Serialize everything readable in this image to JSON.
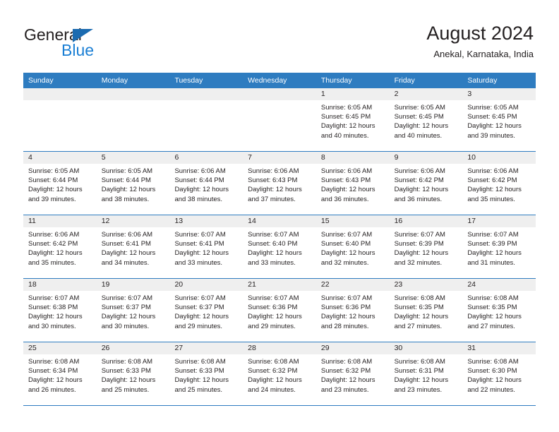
{
  "brand": {
    "name_top": "General",
    "name_bottom": "Blue",
    "triangle_color": "#1b6bb0",
    "blue_color": "#1b7fd4"
  },
  "header": {
    "title": "August 2024",
    "subtitle": "Anekal, Karnataka, India"
  },
  "colors": {
    "header_blue": "#2e7cc0",
    "daynum_gray": "#efefef",
    "text": "#231f20"
  },
  "weekdays": [
    "Sunday",
    "Monday",
    "Tuesday",
    "Wednesday",
    "Thursday",
    "Friday",
    "Saturday"
  ],
  "weeks": [
    [
      {
        "day": "",
        "empty": true
      },
      {
        "day": "",
        "empty": true
      },
      {
        "day": "",
        "empty": true
      },
      {
        "day": "",
        "empty": true
      },
      {
        "day": "1",
        "sunrise": "Sunrise: 6:05 AM",
        "sunset": "Sunset: 6:45 PM",
        "daylight1": "Daylight: 12 hours",
        "daylight2": "and 40 minutes."
      },
      {
        "day": "2",
        "sunrise": "Sunrise: 6:05 AM",
        "sunset": "Sunset: 6:45 PM",
        "daylight1": "Daylight: 12 hours",
        "daylight2": "and 40 minutes."
      },
      {
        "day": "3",
        "sunrise": "Sunrise: 6:05 AM",
        "sunset": "Sunset: 6:45 PM",
        "daylight1": "Daylight: 12 hours",
        "daylight2": "and 39 minutes."
      }
    ],
    [
      {
        "day": "4",
        "sunrise": "Sunrise: 6:05 AM",
        "sunset": "Sunset: 6:44 PM",
        "daylight1": "Daylight: 12 hours",
        "daylight2": "and 39 minutes."
      },
      {
        "day": "5",
        "sunrise": "Sunrise: 6:05 AM",
        "sunset": "Sunset: 6:44 PM",
        "daylight1": "Daylight: 12 hours",
        "daylight2": "and 38 minutes."
      },
      {
        "day": "6",
        "sunrise": "Sunrise: 6:06 AM",
        "sunset": "Sunset: 6:44 PM",
        "daylight1": "Daylight: 12 hours",
        "daylight2": "and 38 minutes."
      },
      {
        "day": "7",
        "sunrise": "Sunrise: 6:06 AM",
        "sunset": "Sunset: 6:43 PM",
        "daylight1": "Daylight: 12 hours",
        "daylight2": "and 37 minutes."
      },
      {
        "day": "8",
        "sunrise": "Sunrise: 6:06 AM",
        "sunset": "Sunset: 6:43 PM",
        "daylight1": "Daylight: 12 hours",
        "daylight2": "and 36 minutes."
      },
      {
        "day": "9",
        "sunrise": "Sunrise: 6:06 AM",
        "sunset": "Sunset: 6:42 PM",
        "daylight1": "Daylight: 12 hours",
        "daylight2": "and 36 minutes."
      },
      {
        "day": "10",
        "sunrise": "Sunrise: 6:06 AM",
        "sunset": "Sunset: 6:42 PM",
        "daylight1": "Daylight: 12 hours",
        "daylight2": "and 35 minutes."
      }
    ],
    [
      {
        "day": "11",
        "sunrise": "Sunrise: 6:06 AM",
        "sunset": "Sunset: 6:42 PM",
        "daylight1": "Daylight: 12 hours",
        "daylight2": "and 35 minutes."
      },
      {
        "day": "12",
        "sunrise": "Sunrise: 6:06 AM",
        "sunset": "Sunset: 6:41 PM",
        "daylight1": "Daylight: 12 hours",
        "daylight2": "and 34 minutes."
      },
      {
        "day": "13",
        "sunrise": "Sunrise: 6:07 AM",
        "sunset": "Sunset: 6:41 PM",
        "daylight1": "Daylight: 12 hours",
        "daylight2": "and 33 minutes."
      },
      {
        "day": "14",
        "sunrise": "Sunrise: 6:07 AM",
        "sunset": "Sunset: 6:40 PM",
        "daylight1": "Daylight: 12 hours",
        "daylight2": "and 33 minutes."
      },
      {
        "day": "15",
        "sunrise": "Sunrise: 6:07 AM",
        "sunset": "Sunset: 6:40 PM",
        "daylight1": "Daylight: 12 hours",
        "daylight2": "and 32 minutes."
      },
      {
        "day": "16",
        "sunrise": "Sunrise: 6:07 AM",
        "sunset": "Sunset: 6:39 PM",
        "daylight1": "Daylight: 12 hours",
        "daylight2": "and 32 minutes."
      },
      {
        "day": "17",
        "sunrise": "Sunrise: 6:07 AM",
        "sunset": "Sunset: 6:39 PM",
        "daylight1": "Daylight: 12 hours",
        "daylight2": "and 31 minutes."
      }
    ],
    [
      {
        "day": "18",
        "sunrise": "Sunrise: 6:07 AM",
        "sunset": "Sunset: 6:38 PM",
        "daylight1": "Daylight: 12 hours",
        "daylight2": "and 30 minutes."
      },
      {
        "day": "19",
        "sunrise": "Sunrise: 6:07 AM",
        "sunset": "Sunset: 6:37 PM",
        "daylight1": "Daylight: 12 hours",
        "daylight2": "and 30 minutes."
      },
      {
        "day": "20",
        "sunrise": "Sunrise: 6:07 AM",
        "sunset": "Sunset: 6:37 PM",
        "daylight1": "Daylight: 12 hours",
        "daylight2": "and 29 minutes."
      },
      {
        "day": "21",
        "sunrise": "Sunrise: 6:07 AM",
        "sunset": "Sunset: 6:36 PM",
        "daylight1": "Daylight: 12 hours",
        "daylight2": "and 29 minutes."
      },
      {
        "day": "22",
        "sunrise": "Sunrise: 6:07 AM",
        "sunset": "Sunset: 6:36 PM",
        "daylight1": "Daylight: 12 hours",
        "daylight2": "and 28 minutes."
      },
      {
        "day": "23",
        "sunrise": "Sunrise: 6:08 AM",
        "sunset": "Sunset: 6:35 PM",
        "daylight1": "Daylight: 12 hours",
        "daylight2": "and 27 minutes."
      },
      {
        "day": "24",
        "sunrise": "Sunrise: 6:08 AM",
        "sunset": "Sunset: 6:35 PM",
        "daylight1": "Daylight: 12 hours",
        "daylight2": "and 27 minutes."
      }
    ],
    [
      {
        "day": "25",
        "sunrise": "Sunrise: 6:08 AM",
        "sunset": "Sunset: 6:34 PM",
        "daylight1": "Daylight: 12 hours",
        "daylight2": "and 26 minutes."
      },
      {
        "day": "26",
        "sunrise": "Sunrise: 6:08 AM",
        "sunset": "Sunset: 6:33 PM",
        "daylight1": "Daylight: 12 hours",
        "daylight2": "and 25 minutes."
      },
      {
        "day": "27",
        "sunrise": "Sunrise: 6:08 AM",
        "sunset": "Sunset: 6:33 PM",
        "daylight1": "Daylight: 12 hours",
        "daylight2": "and 25 minutes."
      },
      {
        "day": "28",
        "sunrise": "Sunrise: 6:08 AM",
        "sunset": "Sunset: 6:32 PM",
        "daylight1": "Daylight: 12 hours",
        "daylight2": "and 24 minutes."
      },
      {
        "day": "29",
        "sunrise": "Sunrise: 6:08 AM",
        "sunset": "Sunset: 6:32 PM",
        "daylight1": "Daylight: 12 hours",
        "daylight2": "and 23 minutes."
      },
      {
        "day": "30",
        "sunrise": "Sunrise: 6:08 AM",
        "sunset": "Sunset: 6:31 PM",
        "daylight1": "Daylight: 12 hours",
        "daylight2": "and 23 minutes."
      },
      {
        "day": "31",
        "sunrise": "Sunrise: 6:08 AM",
        "sunset": "Sunset: 6:30 PM",
        "daylight1": "Daylight: 12 hours",
        "daylight2": "and 22 minutes."
      }
    ]
  ]
}
